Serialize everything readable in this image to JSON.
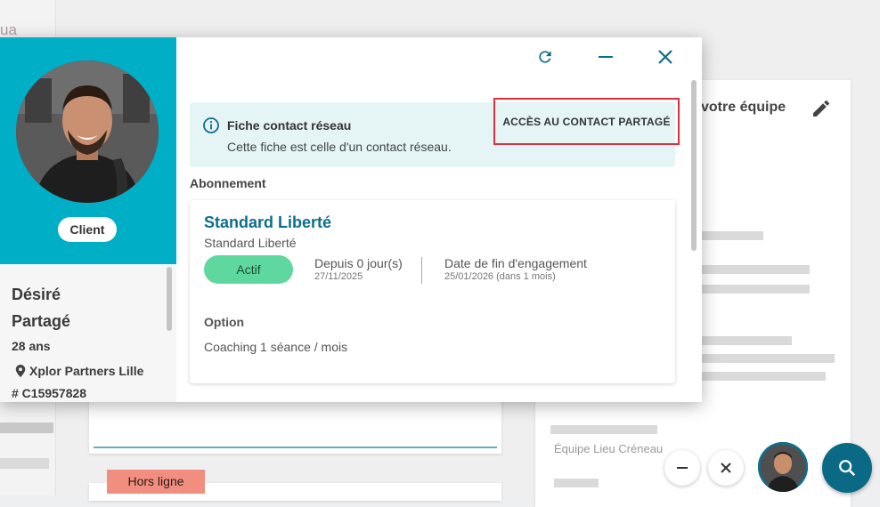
{
  "background": {
    "partial_text": "ua",
    "right_card_title": "votre équipe",
    "offline_badge": "Hors ligne",
    "blurred_caption": "Équipe   Lieu   Créneau"
  },
  "modal": {
    "header": {
      "refresh_icon": "refresh-icon",
      "minimize_icon": "minimize-icon",
      "close_icon": "close-icon"
    },
    "sidebar": {
      "client_badge": "Client",
      "first_name": "Désiré",
      "last_name": "Partagé",
      "age": "28 ans",
      "location": "Xplor Partners Lille",
      "client_id": "# C15957828"
    },
    "banner": {
      "title": "Fiche contact réseau",
      "text": "Cette fiche est celle d'un contact réseau.",
      "action_label": "ACCÈS AU CONTACT PARTAGÉ"
    },
    "subscription": {
      "section_title": "Abonnement",
      "plan_title": "Standard Liberté",
      "plan_subtitle": "Standard Liberté",
      "status": "Actif",
      "since_label": "Depuis 0 jour(s)",
      "since_date": "27/11/2025",
      "end_label": "Date de fin d'engagement",
      "end_date": "25/01/2026 (dans 1 mois)",
      "option_title": "Option",
      "option_text": "Coaching 1 séance / mois"
    }
  },
  "colors": {
    "teal": "#00aec6",
    "dark_teal": "#0d6e8a",
    "status_green": "#5fd8a0",
    "highlight_red": "#e02e3d",
    "offline": "#f28e7f"
  }
}
